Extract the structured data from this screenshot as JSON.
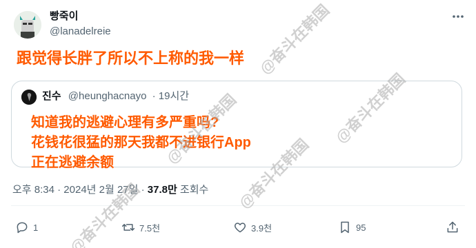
{
  "author": {
    "display_name": "빵죽이",
    "handle": "@lanadelreie"
  },
  "tweet": {
    "text_obscured": "",
    "overlay_caption": "跟觉得长胖了所以不上称的我一样"
  },
  "quote": {
    "name": "진수",
    "handle": "@heunghacnayo",
    "time": "· 19시간",
    "body_obscured": "",
    "overlay_lines": [
      "知道我的逃避心理有多严重吗?",
      "花钱花很猛的那天我都不进银行App",
      "正在逃避余额"
    ]
  },
  "meta": {
    "timestamp": "오후 8:34 · 2024년 2월 27일 · ",
    "views_count": "37.8만",
    "views_label": " 조회수"
  },
  "actions": {
    "replies": "1",
    "reposts": "7.5천",
    "likes": "3.9천",
    "bookmarks": "95"
  },
  "watermark": "@奋斗在韩国",
  "colors": {
    "overlay": "#ff5a00",
    "secondary_text": "#536471",
    "border": "#cfd9de"
  }
}
